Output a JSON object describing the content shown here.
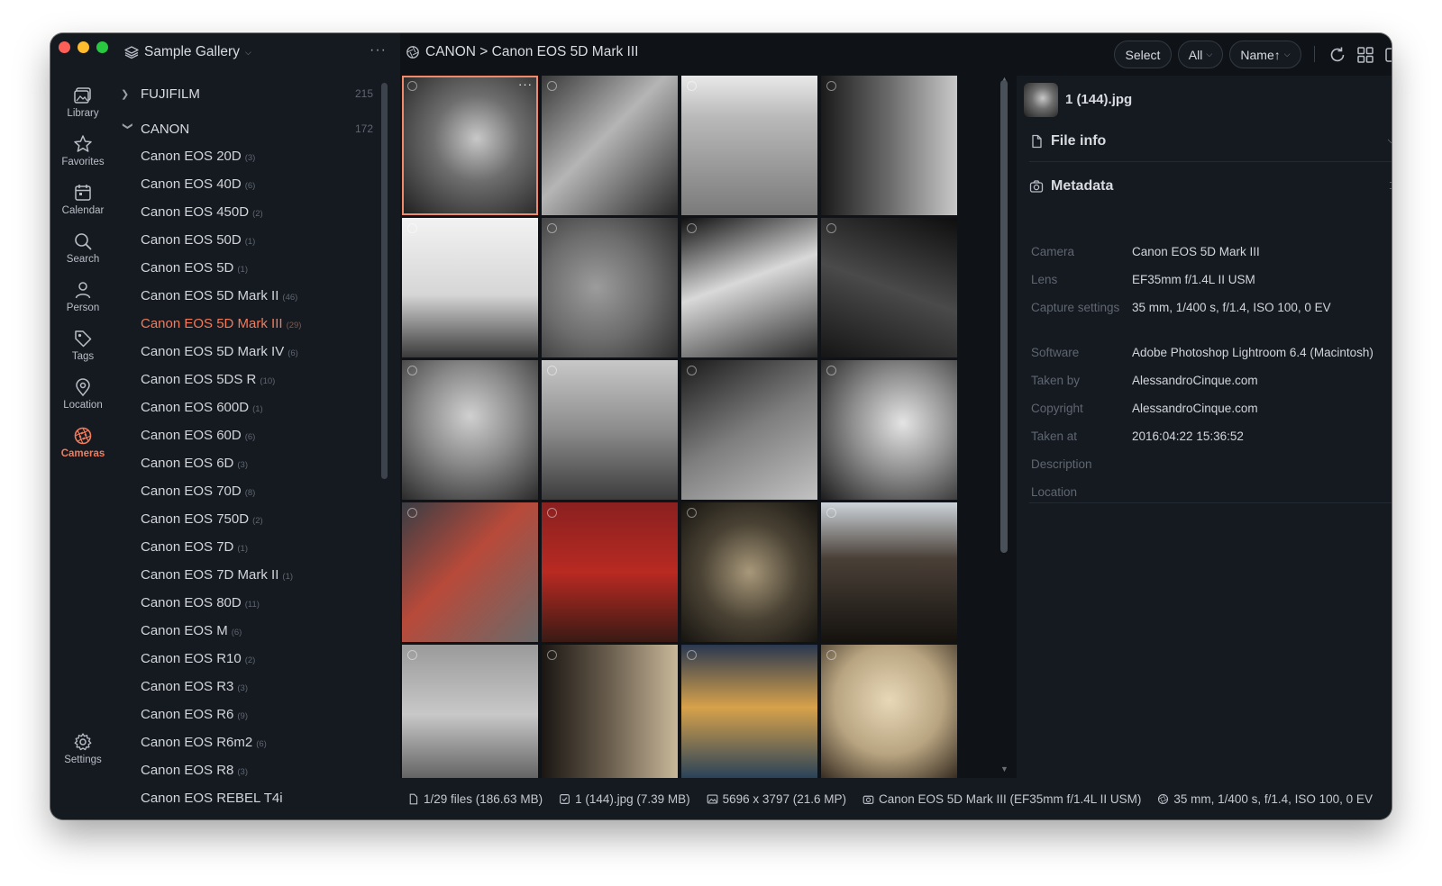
{
  "window": {
    "traffic_colors": [
      "#ff5f57",
      "#febc2e",
      "#28c840"
    ]
  },
  "rail": {
    "items": [
      {
        "label": "Library",
        "icon": "library-icon"
      },
      {
        "label": "Favorites",
        "icon": "star-icon"
      },
      {
        "label": "Calendar",
        "icon": "calendar-icon"
      },
      {
        "label": "Search",
        "icon": "search-icon"
      },
      {
        "label": "Person",
        "icon": "person-icon"
      },
      {
        "label": "Tags",
        "icon": "tag-icon"
      },
      {
        "label": "Location",
        "icon": "location-pin-icon"
      },
      {
        "label": "Cameras",
        "icon": "aperture-icon",
        "active": true
      }
    ],
    "settings": "Settings"
  },
  "sidebar": {
    "gallery_title": "Sample Gallery",
    "more": "···",
    "brands": [
      {
        "name": "FUJIFILM",
        "count": "215",
        "expanded": false
      },
      {
        "name": "CANON",
        "count": "172",
        "expanded": true
      }
    ],
    "models": [
      {
        "name": "Canon EOS 20D",
        "count": "(3)"
      },
      {
        "name": "Canon EOS 40D",
        "count": "(6)"
      },
      {
        "name": "Canon EOS 450D",
        "count": "(2)"
      },
      {
        "name": "Canon EOS 50D",
        "count": "(1)"
      },
      {
        "name": "Canon EOS 5D",
        "count": "(1)"
      },
      {
        "name": "Canon EOS 5D Mark II",
        "count": "(46)"
      },
      {
        "name": "Canon EOS 5D Mark III",
        "count": "(29)",
        "selected": true
      },
      {
        "name": "Canon EOS 5D Mark IV",
        "count": "(6)"
      },
      {
        "name": "Canon EOS 5DS R",
        "count": "(10)"
      },
      {
        "name": "Canon EOS 600D",
        "count": "(1)"
      },
      {
        "name": "Canon EOS 60D",
        "count": "(6)"
      },
      {
        "name": "Canon EOS 6D",
        "count": "(3)"
      },
      {
        "name": "Canon EOS 70D",
        "count": "(8)"
      },
      {
        "name": "Canon EOS 750D",
        "count": "(2)"
      },
      {
        "name": "Canon EOS 7D",
        "count": "(1)"
      },
      {
        "name": "Canon EOS 7D Mark II",
        "count": "(1)"
      },
      {
        "name": "Canon EOS 80D",
        "count": "(11)"
      },
      {
        "name": "Canon EOS M",
        "count": "(6)"
      },
      {
        "name": "Canon EOS R10",
        "count": "(2)"
      },
      {
        "name": "Canon EOS R3",
        "count": "(3)"
      },
      {
        "name": "Canon EOS R6",
        "count": "(9)"
      },
      {
        "name": "Canon EOS R6m2",
        "count": "(6)"
      },
      {
        "name": "Canon EOS R8",
        "count": "(3)"
      },
      {
        "name": "Canon EOS REBEL T4i",
        "count": ""
      }
    ]
  },
  "toolbar": {
    "breadcrumb": "CANON > Canon EOS 5D Mark III",
    "select": "Select",
    "filter": "All",
    "sort": "Name↑"
  },
  "grid": {
    "accent": "#f08a6a",
    "thumbs": [
      {
        "bg": "radial-gradient(circle at 55% 45%, #c8c8c8 0%, #6e6e6e 40%, #1e1e1e 100%)",
        "selected": true
      },
      {
        "bg": "linear-gradient(135deg, #3a3a3a 0%, #b5b5b5 45%, #2a2a2a 100%)"
      },
      {
        "bg": "linear-gradient(180deg, #e9e9e9 0%, #b9b9b9 30%, #7a7a7a 100%)"
      },
      {
        "bg": "linear-gradient(90deg, #1a1a1a 0%, #6a6a6a 50%, #c9c9c9 100%)"
      },
      {
        "bg": "linear-gradient(180deg, #f2f2f2 0%, #d6d6d6 55%, #3a3a3a 100%)"
      },
      {
        "bg": "radial-gradient(circle at 40% 50%, #9c9c9c 0%, #6c6c6c 50%, #2e2e2e 100%)"
      },
      {
        "bg": "linear-gradient(160deg, #101010 0%, #d9d9d9 45%, #2a2a2a 100%)"
      },
      {
        "bg": "linear-gradient(200deg, #0e0e0e 0%, #4a4a4a 50%, #151515 100%)"
      },
      {
        "bg": "radial-gradient(circle at 50% 40%, #d0d0d0 0%, #8a8a8a 45%, #2a2a2a 100%)"
      },
      {
        "bg": "linear-gradient(180deg, #c8c8c8 0%, #8c8c8c 50%, #3c3c3c 100%)"
      },
      {
        "bg": "linear-gradient(150deg, #1a1a1a 0%, #7e7e7e 50%, #c2c2c2 100%)"
      },
      {
        "bg": "radial-gradient(circle at 60% 45%, #e4e4e4 0%, #8e8e8e 45%, #1c1c1c 100%)"
      },
      {
        "bg": "linear-gradient(135deg, #3a3d44 0%, #b84a3a 45%, #6a6a6a 100%)"
      },
      {
        "bg": "linear-gradient(180deg, #8a2020 0%, #b82a22 50%, #3a1a14 100%)"
      },
      {
        "bg": "radial-gradient(circle at 50% 50%, #a8987a 0%, #4a4234 50%, #161410 100%)"
      },
      {
        "bg": "linear-gradient(180deg, #cdd4da 0%, #4a4038 40%, #15120e 100%)"
      },
      {
        "bg": "linear-gradient(180deg, #9a9a9a 0%, #c8c8c8 50%, #5a5a5a 100%)"
      },
      {
        "bg": "linear-gradient(90deg, #1a1612 0%, #6a5e4e 50%, #c9b89a 100%)"
      },
      {
        "bg": "linear-gradient(180deg, #2a3850 0%, #d7a24a 45%, #1a3a5a 100%)"
      },
      {
        "bg": "radial-gradient(circle at 50% 40%, #e8d8b8 0%, #b8a480 50%, #2a2018 100%)"
      }
    ]
  },
  "panel": {
    "filename": "1 (144).jpg",
    "file_info_title": "File info",
    "metadata_title": "Metadata",
    "metadata": [
      {
        "key": "Camera",
        "value": "Canon EOS 5D Mark III"
      },
      {
        "key": "Lens",
        "value": "EF35mm f/1.4L II USM"
      },
      {
        "key": "Capture settings",
        "value": "35 mm, 1/400 s, f/1.4, ISO 100, 0 EV"
      },
      {
        "key": "Software",
        "value": "Adobe Photoshop Lightroom 6.4 (Macintosh)"
      },
      {
        "key": "Taken by",
        "value": "AlessandroCinque.com"
      },
      {
        "key": "Copyright",
        "value": "AlessandroCinque.com"
      },
      {
        "key": "Taken at",
        "value": "2016:04:22 15:36:52"
      },
      {
        "key": "Description",
        "value": ""
      },
      {
        "key": "Location",
        "value": ""
      }
    ]
  },
  "status": {
    "files": "1/29 files (186.63 MB)",
    "selected": "1 (144).jpg (7.39 MB)",
    "dimensions": "5696 x 3797 (21.6 MP)",
    "camera": "Canon EOS 5D Mark III (EF35mm f/1.4L II USM)",
    "exposure": "35 mm, 1/400 s, f/1.4, ISO 100, 0 EV"
  }
}
